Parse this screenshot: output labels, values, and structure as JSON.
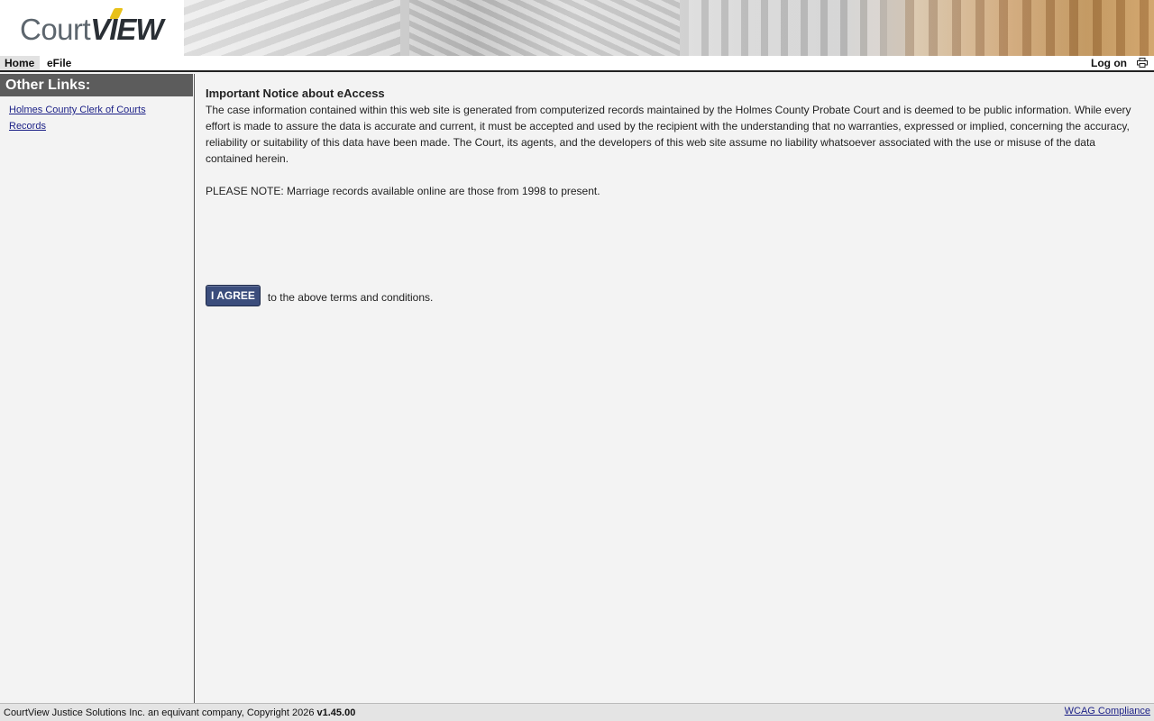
{
  "header": {
    "logo_court": "Court",
    "logo_view": "VIEW"
  },
  "nav": {
    "tabs": [
      {
        "label": "Home",
        "active": true
      },
      {
        "label": "eFile",
        "active": false
      }
    ],
    "logon_label": "Log on",
    "print_icon": "printer-icon"
  },
  "sidebar": {
    "title": "Other Links:",
    "links": [
      {
        "label": "Holmes County Clerk of Courts"
      },
      {
        "label": "Records"
      }
    ]
  },
  "main": {
    "notice_title": "Important Notice about eAccess",
    "notice_body": "The case information contained within this web site is generated from computerized records maintained by the Holmes County Probate Court and is deemed to be public information. While every effort is made to assure the data is accurate and current, it must be accepted and used by the recipient with the understanding that no warranties, expressed or implied, concerning the accuracy, reliability or suitability of this data have been made. The Court, its agents, and the developers of this web site assume no liability whatsoever associated with the use or misuse of the data contained herein.",
    "note": "PLEASE NOTE:  Marriage records available online are those from 1998 to present.",
    "agree_button": "I AGREE",
    "agree_text": "to the above terms and conditions."
  },
  "footer": {
    "copyright": "CourtView Justice Solutions Inc. an equivant company, Copyright 2026 ",
    "version": "v1.45.00",
    "wcag_link": "WCAG Compliance"
  },
  "colors": {
    "button_bg": "#3b4d7c",
    "sidebar_title_bg": "#5c5c5c",
    "link": "#1a1f86"
  }
}
